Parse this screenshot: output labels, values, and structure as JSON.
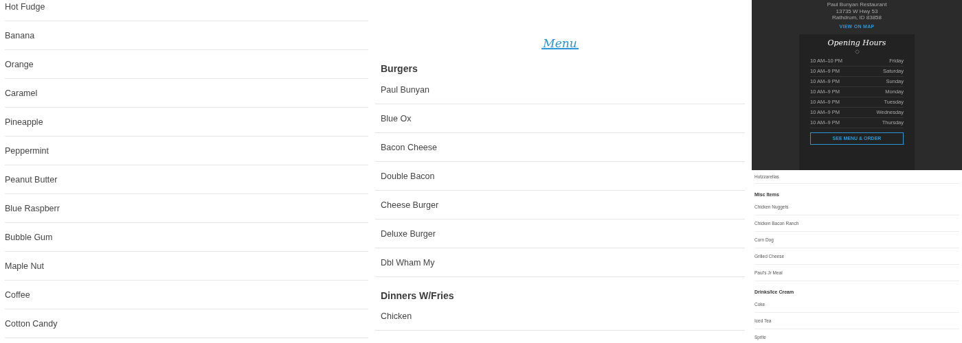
{
  "flavors": [
    "Hot Fudge",
    "Banana",
    "Orange",
    "Caramel",
    "Pineapple",
    "Peppermint",
    "Peanut Butter",
    "Blue Raspberr",
    "Bubble Gum",
    "Maple Nut",
    "Coffee",
    "Cotton Candy"
  ],
  "menu": {
    "title": "Menu",
    "sections": [
      {
        "heading": "Burgers",
        "items": [
          "Paul Bunyan",
          "Blue Ox",
          "Bacon Cheese",
          "Double Bacon",
          "Cheese Burger",
          "Deluxe Burger",
          "Dbl Wham My"
        ]
      },
      {
        "heading": "Dinners W/Fries",
        "items": [
          "Chicken"
        ]
      }
    ]
  },
  "location": {
    "address": [
      "Paul Bunyan Restaurant",
      "13735 W Hwy 53",
      "Rathdrum, ID 83858"
    ],
    "map_link": "VIEW ON MAP",
    "hours_title": "Opening Hours",
    "hours": [
      {
        "time": "10 AM–10 PM",
        "day": "Friday"
      },
      {
        "time": "10 AM–9 PM",
        "day": "Saturday"
      },
      {
        "time": "10 AM–9 PM",
        "day": "Sunday"
      },
      {
        "time": "10 AM–9 PM",
        "day": "Monday"
      },
      {
        "time": "10 AM–9 PM",
        "day": "Tuesday"
      },
      {
        "time": "10 AM–9 PM",
        "day": "Wednesday"
      },
      {
        "time": "10 AM–9 PM",
        "day": "Thursday"
      }
    ],
    "order_button": "SEE MENU & ORDER"
  },
  "side_menu": [
    {
      "kind": "item",
      "text": "Hotzzarellas"
    },
    {
      "kind": "heading",
      "text": "Misc Items"
    },
    {
      "kind": "item",
      "text": "Chicken Nuggets"
    },
    {
      "kind": "item",
      "text": "Chicken Bacon Ranch"
    },
    {
      "kind": "item",
      "text": "Corn Dog"
    },
    {
      "kind": "item",
      "text": "Grilled Cheese"
    },
    {
      "kind": "item",
      "text": "Paul's Jr Meal"
    },
    {
      "kind": "heading",
      "text": "Drinks/Ice Cream"
    },
    {
      "kind": "item",
      "text": "Coke"
    },
    {
      "kind": "item",
      "text": "Iced Tea"
    },
    {
      "kind": "item",
      "text": "Sprite"
    }
  ]
}
